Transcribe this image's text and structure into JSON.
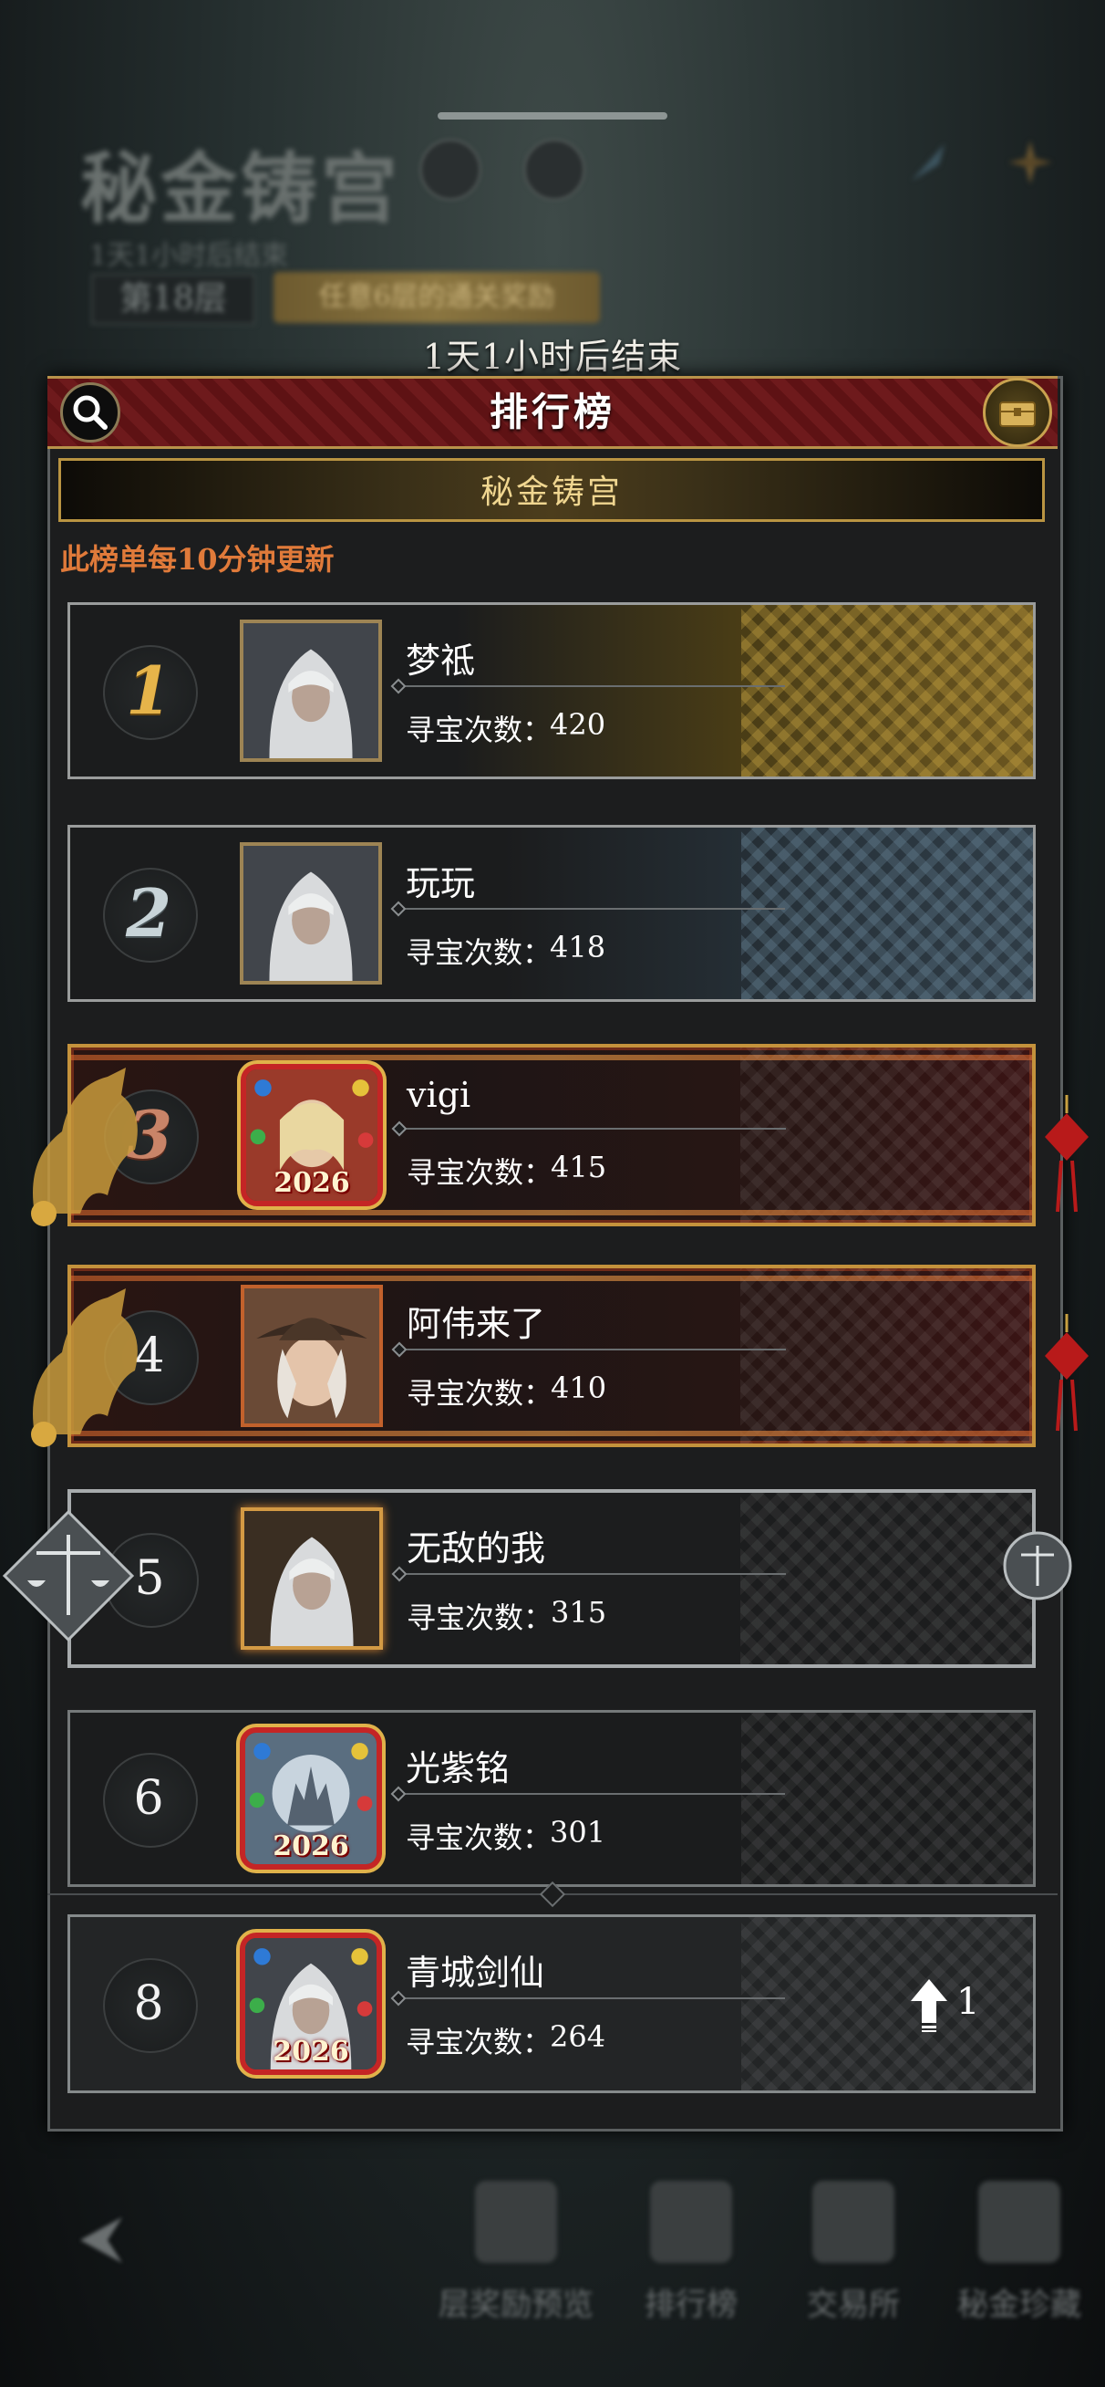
{
  "background": {
    "title": "秘金铸宫",
    "subtitle": "1天1小时后结束",
    "floor": "第18层",
    "ribbon": "任意6层的通关奖励"
  },
  "countdown": "1天1小时后结束",
  "panel": {
    "title": "排行榜",
    "category_tab": "秘金铸宫",
    "update_note": "此榜单每10分钟更新"
  },
  "stat_label": "寻宝次数：",
  "rows": [
    {
      "rank": "1",
      "name": "梦祗",
      "value": "420",
      "style": "gold"
    },
    {
      "rank": "2",
      "name": "玩玩",
      "value": "418",
      "style": "silver"
    },
    {
      "rank": "3",
      "name": "vigi",
      "value": "415",
      "style": "bronze",
      "avatar_year": "2026"
    },
    {
      "rank": "4",
      "name": "阿伟来了",
      "value": "410",
      "style": "fancy"
    },
    {
      "rank": "5",
      "name": "无敌的我",
      "value": "315",
      "style": "scales"
    },
    {
      "rank": "6",
      "name": "光紫铭",
      "value": "301",
      "style": "plain",
      "avatar_year": "2026"
    }
  ],
  "my_row": {
    "rank": "8",
    "name": "青城剑仙",
    "value": "264",
    "avatar_year": "2026",
    "change": "1"
  },
  "bottom_nav": {
    "items": [
      "层奖励预览",
      "排行榜",
      "交易所",
      "秘金珍藏"
    ]
  },
  "colors": {
    "accent_gold": "#c9a24f",
    "header_red": "#6e1a1c",
    "note_orange": "#e07a3a"
  }
}
